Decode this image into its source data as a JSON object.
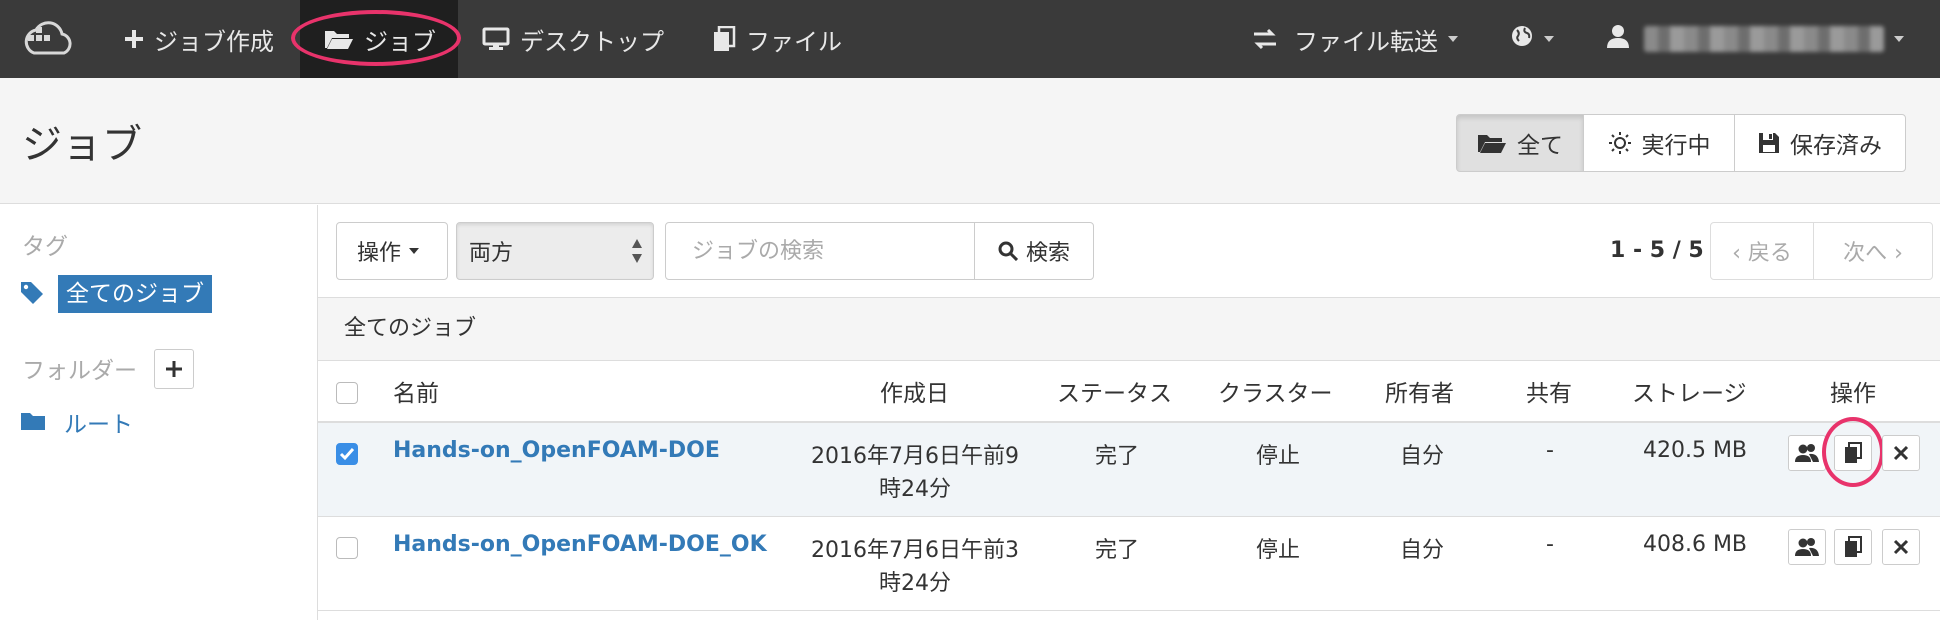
{
  "nav": {
    "logo_icon": "cloud-logo-icon",
    "create_job": "ジョブ作成",
    "jobs": "ジョブ",
    "desktop": "デスクトップ",
    "files": "ファイル",
    "file_transfer": "ファイル転送"
  },
  "header": {
    "title": "ジョブ",
    "filters": {
      "all": "全て",
      "running": "実行中",
      "saved": "保存済み"
    }
  },
  "sidebar": {
    "tags_heading": "タグ",
    "all_jobs_tag": "全てのジョブ",
    "folders_heading": "フォルダー",
    "root_folder": "ルート"
  },
  "toolbar": {
    "actions": "操作",
    "scope_select": "両方",
    "search_placeholder": "ジョブの検索",
    "search_button": "検索",
    "pager_count": "1 - 5 / 5",
    "prev": "‹ 戻る",
    "next": "次へ ›"
  },
  "table": {
    "panel_title": "全てのジョブ",
    "columns": {
      "name": "名前",
      "created": "作成日",
      "status": "ステータス",
      "cluster": "クラスター",
      "owner": "所有者",
      "shared": "共有",
      "storage": "ストレージ",
      "actions": "操作"
    },
    "rows": [
      {
        "checked": true,
        "name": "Hands-on_OpenFOAM-DOE",
        "created_line1": "2016年7月6日午前9",
        "created_line2": "時24分",
        "status": "完了",
        "cluster": "停止",
        "owner": "自分",
        "shared": "-",
        "storage": "420.5 MB"
      },
      {
        "checked": false,
        "name": "Hands-on_OpenFOAM-DOE_OK",
        "created_line1": "2016年7月6日午前3",
        "created_line2": "時24分",
        "status": "完了",
        "cluster": "停止",
        "owner": "自分",
        "shared": "-",
        "storage": "408.6 MB"
      }
    ]
  },
  "colors": {
    "accent": "#337ab7",
    "highlight": "#e8336b",
    "navbar": "#3a3a3a"
  }
}
